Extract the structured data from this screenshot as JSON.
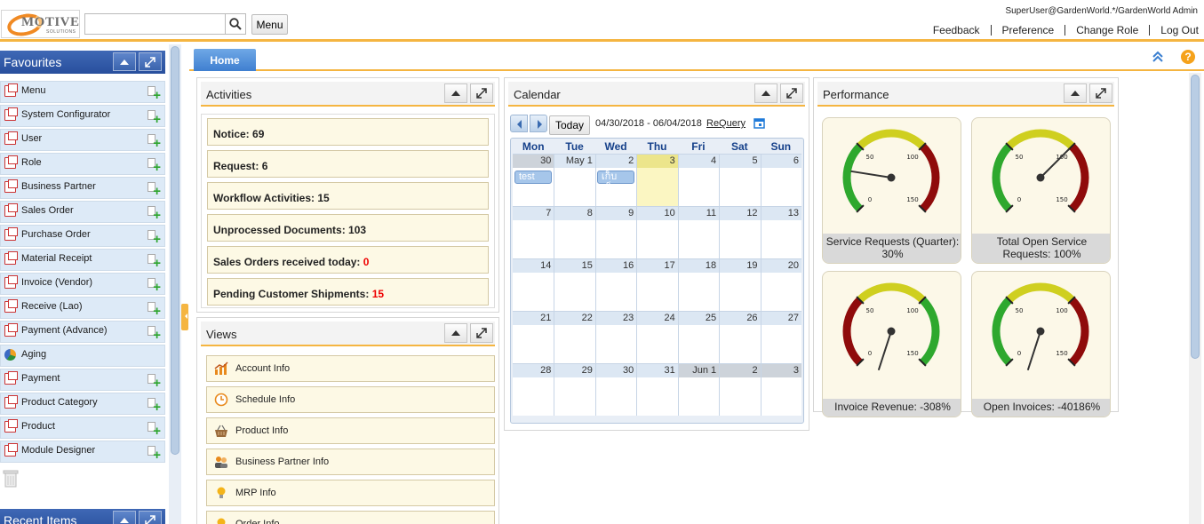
{
  "header": {
    "logo_text": "MOTIVE",
    "logo_subtext": "SOLUTIONS",
    "search_placeholder": "",
    "menu_label": "Menu",
    "user_label": "SuperUser@GardenWorld.*/GardenWorld Admin",
    "links": [
      "Feedback",
      "Preference",
      "Change Role",
      "Log Out"
    ],
    "accent_color": "#f5b541"
  },
  "favourites": {
    "title": "Favourites",
    "items": [
      {
        "label": "Menu",
        "icon": "window-icon"
      },
      {
        "label": "System Configurator",
        "icon": "window-icon"
      },
      {
        "label": "User",
        "icon": "window-icon"
      },
      {
        "label": "Role",
        "icon": "window-icon"
      },
      {
        "label": "Business Partner",
        "icon": "window-icon"
      },
      {
        "label": "Sales Order",
        "icon": "window-icon"
      },
      {
        "label": "Purchase Order",
        "icon": "window-icon"
      },
      {
        "label": "Material Receipt",
        "icon": "window-icon"
      },
      {
        "label": "Invoice (Vendor)",
        "icon": "window-icon"
      },
      {
        "label": "Receive (Lao)",
        "icon": "window-icon"
      },
      {
        "label": "Payment (Advance)",
        "icon": "window-icon"
      },
      {
        "label": "Aging",
        "icon": "report-pie-icon"
      },
      {
        "label": "Payment",
        "icon": "window-icon"
      },
      {
        "label": "Product Category",
        "icon": "window-icon"
      },
      {
        "label": "Product",
        "icon": "window-icon"
      },
      {
        "label": "Module Designer",
        "icon": "window-icon"
      }
    ]
  },
  "recent": {
    "title": "Recent Items"
  },
  "tabs": {
    "home": "Home"
  },
  "activities": {
    "title": "Activities",
    "items": [
      {
        "label": "Notice: ",
        "value": "69",
        "highlight": false
      },
      {
        "label": "Request: ",
        "value": "6",
        "highlight": false
      },
      {
        "label": "Workflow Activities: ",
        "value": "15",
        "highlight": false
      },
      {
        "label": "Unprocessed Documents: ",
        "value": "103",
        "highlight": false
      },
      {
        "label": "Sales Orders received today: ",
        "value": "0",
        "highlight": true
      },
      {
        "label": "Pending Customer Shipments: ",
        "value": "15",
        "highlight": true
      }
    ]
  },
  "views": {
    "title": "Views",
    "items": [
      {
        "label": "Account Info",
        "icon": "chart-icon"
      },
      {
        "label": "Schedule Info",
        "icon": "clock-icon"
      },
      {
        "label": "Product Info",
        "icon": "basket-icon"
      },
      {
        "label": "Business Partner Info",
        "icon": "people-icon"
      },
      {
        "label": "MRP Info",
        "icon": "lightbulb-icon"
      },
      {
        "label": "Order Info",
        "icon": "lightbulb-icon"
      }
    ]
  },
  "calendar": {
    "title": "Calendar",
    "today_label": "Today",
    "range": "04/30/2018 - 06/04/2018",
    "requery_label": "ReQuery",
    "days_of_week": [
      "Mon",
      "Tue",
      "Wed",
      "Thu",
      "Fri",
      "Sat",
      "Sun"
    ],
    "weeks": [
      [
        {
          "d": "30",
          "o": true
        },
        {
          "d": "May 1",
          "o": false
        },
        {
          "d": "2",
          "o": false
        },
        {
          "d": "3",
          "o": false,
          "t": true
        },
        {
          "d": "4",
          "o": false
        },
        {
          "d": "5",
          "o": false
        },
        {
          "d": "6",
          "o": false
        }
      ],
      [
        {
          "d": "7"
        },
        {
          "d": "8"
        },
        {
          "d": "9"
        },
        {
          "d": "10"
        },
        {
          "d": "11"
        },
        {
          "d": "12"
        },
        {
          "d": "13"
        }
      ],
      [
        {
          "d": "14"
        },
        {
          "d": "15"
        },
        {
          "d": "16"
        },
        {
          "d": "17"
        },
        {
          "d": "18"
        },
        {
          "d": "19"
        },
        {
          "d": "20"
        }
      ],
      [
        {
          "d": "21"
        },
        {
          "d": "22"
        },
        {
          "d": "23"
        },
        {
          "d": "24"
        },
        {
          "d": "25"
        },
        {
          "d": "26"
        },
        {
          "d": "27"
        }
      ],
      [
        {
          "d": "28"
        },
        {
          "d": "29"
        },
        {
          "d": "30"
        },
        {
          "d": "31"
        },
        {
          "d": "Jun 1",
          "o": true
        },
        {
          "d": "2",
          "o": true
        },
        {
          "d": "3",
          "o": true
        }
      ]
    ],
    "events": [
      {
        "label": "test",
        "week": 0,
        "day": 0
      },
      {
        "label": "เก็บเช็ค",
        "week": 0,
        "day": 2
      }
    ]
  },
  "performance": {
    "title": "Performance",
    "gauges": [
      {
        "label": "Service Requests (Quarter): 30%",
        "value": 30,
        "ticks": [
          "0",
          "50",
          "100",
          "150"
        ],
        "bands": [
          "#2ea82e",
          "#cfcf1f",
          "#8f0b0b"
        ]
      },
      {
        "label": "Total Open Service Requests: 100%",
        "value": 100,
        "ticks": [
          "0",
          "50",
          "100",
          "150"
        ],
        "bands": [
          "#2ea82e",
          "#cfcf1f",
          "#8f0b0b"
        ]
      },
      {
        "label": "Invoice Revenue: -308%",
        "value": -308,
        "ticks": [
          "0",
          "50",
          "100",
          "150"
        ],
        "bands": [
          "#8f0b0b",
          "#cfcf1f",
          "#2ea82e"
        ]
      },
      {
        "label": "Open Invoices: -40186%",
        "value": -40186,
        "ticks": [
          "0",
          "50",
          "100",
          "150"
        ],
        "bands": [
          "#2ea82e",
          "#cfcf1f",
          "#8f0b0b"
        ]
      }
    ]
  }
}
